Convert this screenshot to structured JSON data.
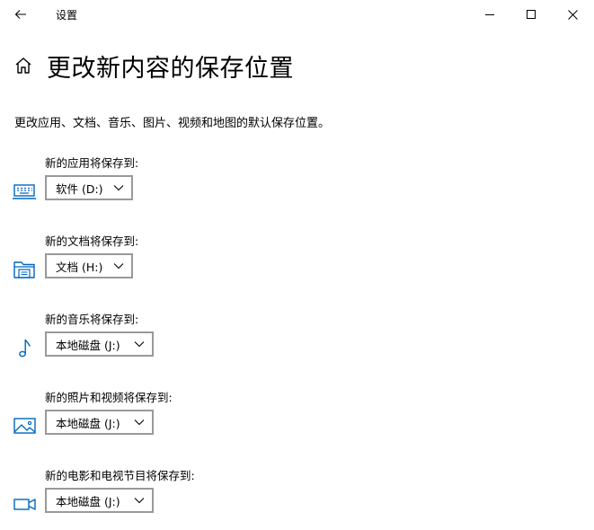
{
  "window": {
    "title": "设置"
  },
  "header": {
    "title": "更改新内容的保存位置",
    "description": "更改应用、文档、音乐、图片、视频和地图的默认保存位置。"
  },
  "settings": [
    {
      "label": "新的应用将保存到:",
      "value": "软件 (D:)",
      "icon": "keyboard-icon"
    },
    {
      "label": "新的文档将保存到:",
      "value": "文档 (H:)",
      "icon": "folder-icon"
    },
    {
      "label": "新的音乐将保存到:",
      "value": "本地磁盘 (J:)",
      "icon": "music-note-icon"
    },
    {
      "label": "新的照片和视频将保存到:",
      "value": "本地磁盘 (J:)",
      "icon": "image-icon"
    },
    {
      "label": "新的电影和电视节目将保存到:",
      "value": "本地磁盘 (J:)",
      "icon": "video-camera-icon"
    }
  ],
  "colors": {
    "accent": "#0067c0",
    "dropdown_border": "#999999"
  }
}
